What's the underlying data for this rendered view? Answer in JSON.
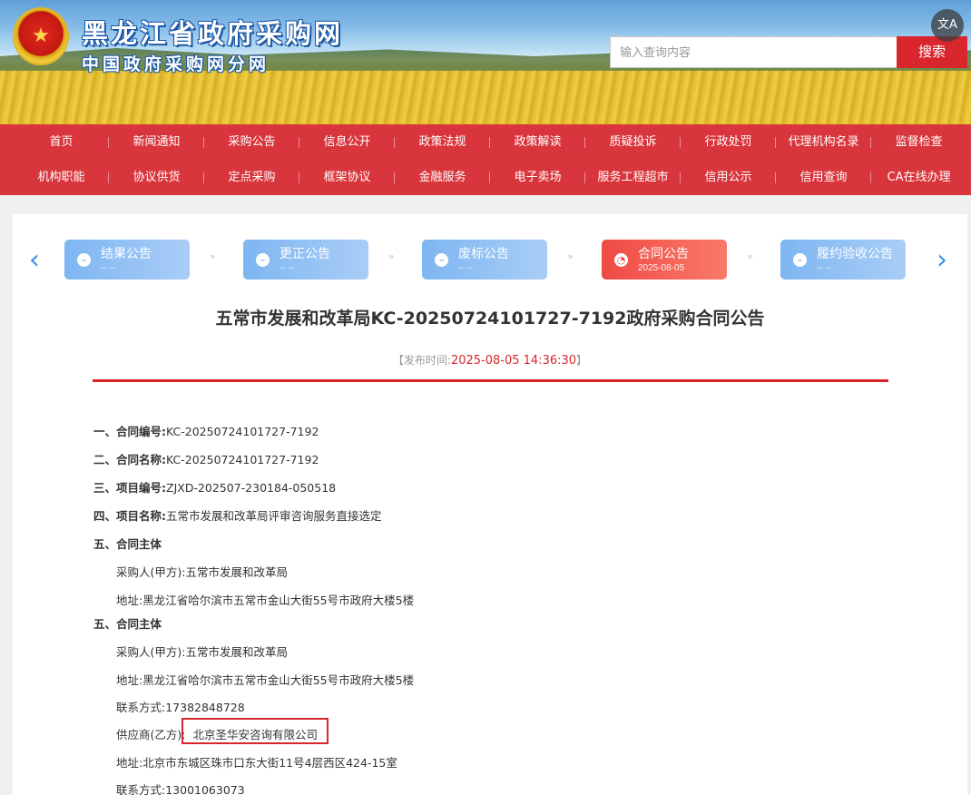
{
  "header": {
    "site_title": "黑龙江省政府采购网",
    "site_subtitle": "中国政府采购网分网",
    "search_placeholder": "输入查询内容",
    "search_button": "搜索",
    "translate_icon": "translate-icon"
  },
  "nav": {
    "row1": [
      "首页",
      "新闻通知",
      "采购公告",
      "信息公开",
      "政策法规",
      "政策解读",
      "质疑投诉",
      "行政处罚",
      "代理机构名录",
      "监督检查"
    ],
    "row2": [
      "机构职能",
      "协议供货",
      "定点采购",
      "框架协议",
      "金融服务",
      "电子卖场",
      "服务工程超市",
      "信用公示",
      "信用查询",
      "CA在线办理"
    ]
  },
  "steps": [
    {
      "label": "结果公告",
      "date": "-- --",
      "active": false
    },
    {
      "label": "更正公告",
      "date": "-- --",
      "active": false
    },
    {
      "label": "废标公告",
      "date": "-- --",
      "active": false
    },
    {
      "label": "合同公告",
      "date": "2025-08-05",
      "active": true
    },
    {
      "label": "履约验收公告",
      "date": "-- --",
      "active": false
    }
  ],
  "notice": {
    "title": "五常市发展和改革局KC-20250724101727-7192政府采购合同公告",
    "pub_time_prefix": "【发布时间:",
    "pub_time_value": "2025-08-05 14:36:30",
    "pub_time_suffix": "】"
  },
  "content": {
    "l1_key": "一、合同编号:",
    "l1_val": "KC-20250724101727-7192",
    "l2_key": "二、合同名称:",
    "l2_val": "KC-20250724101727-7192",
    "l3_key": "三、项目编号:",
    "l3_val": "ZJXD-202507-230184-050518",
    "l4_key": "四、项目名称:",
    "l4_val": "五常市发展和改革局评审咨询服务直接选定",
    "l5_key": "五、合同主体",
    "l5a": "采购人(甲方):五常市发展和改革局",
    "l5b": "地址:黑龙江省哈尔滨市五常市金山大街55号市政府大楼5楼",
    "l6_key": "五、合同主体",
    "l6a": "采购人(甲方):五常市发展和改革局",
    "l6b": "地址:黑龙江省哈尔滨市五常市金山大街55号市政府大楼5楼",
    "l6c": "联系方式:17382848728",
    "l6d_label": "供应商(乙方):",
    "l6d_value": "北京圣华安咨询有限公司",
    "l6e": "地址:北京市东城区珠市口东大街11号4层西区424-15室",
    "l6f": "联系方式:13001063073"
  },
  "colors": {
    "brand_red": "#d9262c",
    "step_blue": "#7eb6f2",
    "step_active": "#ef4a45"
  }
}
